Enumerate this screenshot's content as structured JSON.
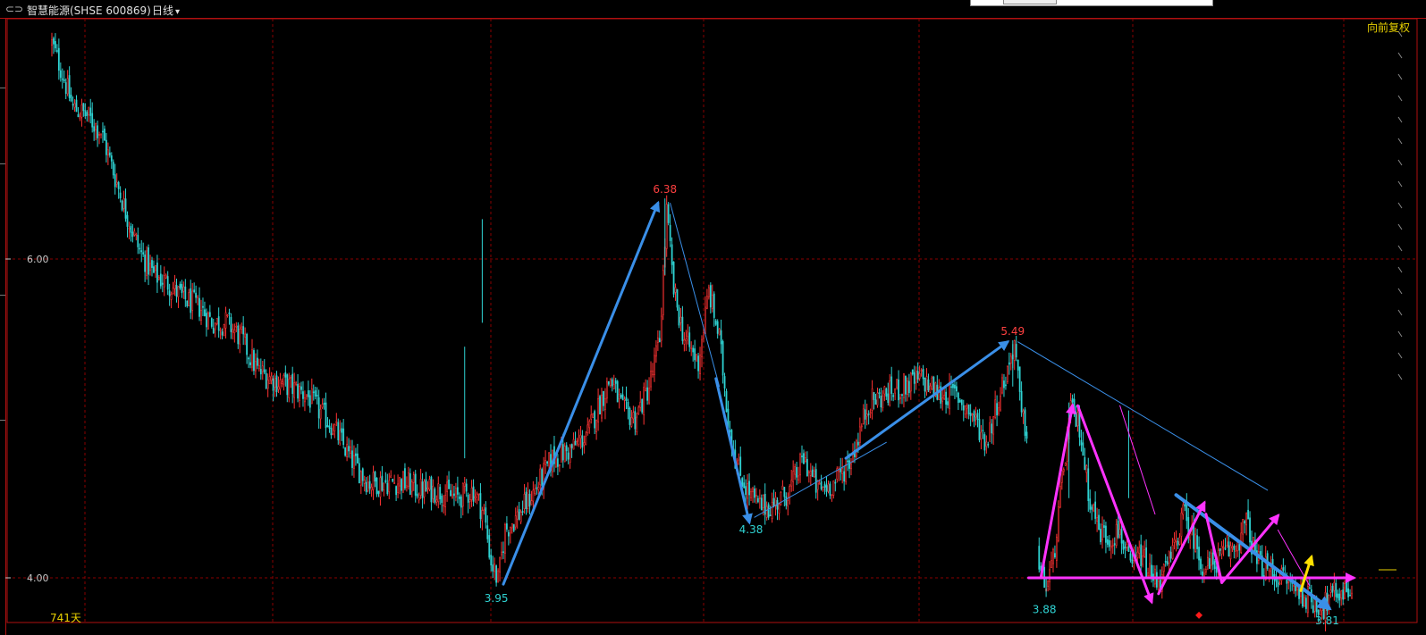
{
  "window": {
    "grip_icon": "⊂⊃",
    "stock_title": "智慧能源(SHSE 600869)",
    "period": "日线",
    "adjust": "向前复权",
    "day_count": "741天"
  },
  "colors": {
    "up": "#ff3333",
    "down": "#2fd3d3",
    "grid": "#8a0000",
    "trend_blue": "#3a8fe8",
    "trend_magenta": "#ff33ff",
    "trend_yellow": "#ffe000",
    "high_label": "#ff4040",
    "low_label": "#2fd3d3"
  },
  "chart_data": {
    "type": "candlestick",
    "title": "智慧能源(SHSE 600869) 日线",
    "ylim": [
      3.78,
      7.4
    ],
    "y_ticks": [
      "6.00",
      "4.00"
    ],
    "y_tick_values": [
      6.0,
      4.0
    ],
    "trading_days": 741,
    "grid": true,
    "price_profile": [
      [
        0,
        7.35
      ],
      [
        5,
        7.2
      ],
      [
        12,
        6.95
      ],
      [
        20,
        6.9
      ],
      [
        28,
        6.8
      ],
      [
        35,
        6.55
      ],
      [
        42,
        6.3
      ],
      [
        50,
        6.05
      ],
      [
        58,
        5.9
      ],
      [
        66,
        5.85
      ],
      [
        75,
        5.75
      ],
      [
        84,
        5.7
      ],
      [
        92,
        5.6
      ],
      [
        100,
        5.6
      ],
      [
        108,
        5.5
      ],
      [
        117,
        5.3
      ],
      [
        125,
        5.25
      ],
      [
        135,
        5.2
      ],
      [
        145,
        5.15
      ],
      [
        152,
        5.05
      ],
      [
        160,
        4.95
      ],
      [
        170,
        4.75
      ],
      [
        180,
        4.6
      ],
      [
        190,
        4.6
      ],
      [
        200,
        4.6
      ],
      [
        210,
        4.55
      ],
      [
        220,
        4.55
      ],
      [
        230,
        4.5
      ],
      [
        240,
        4.55
      ],
      [
        246,
        4.4
      ],
      [
        250,
        4.1
      ],
      [
        254,
        3.98
      ],
      [
        258,
        4.3
      ],
      [
        266,
        4.4
      ],
      [
        275,
        4.55
      ],
      [
        285,
        4.75
      ],
      [
        295,
        4.8
      ],
      [
        305,
        4.9
      ],
      [
        312,
        5.1
      ],
      [
        318,
        5.25
      ],
      [
        325,
        5.05
      ],
      [
        332,
        5.0
      ],
      [
        340,
        5.2
      ],
      [
        346,
        5.5
      ],
      [
        350,
        6.3
      ],
      [
        354,
        5.8
      ],
      [
        360,
        5.5
      ],
      [
        368,
        5.35
      ],
      [
        374,
        5.8
      ],
      [
        380,
        5.5
      ],
      [
        385,
        5.0
      ],
      [
        390,
        4.7
      ],
      [
        396,
        4.55
      ],
      [
        402,
        4.45
      ],
      [
        410,
        4.45
      ],
      [
        420,
        4.55
      ],
      [
        428,
        4.75
      ],
      [
        436,
        4.55
      ],
      [
        446,
        4.6
      ],
      [
        455,
        4.75
      ],
      [
        465,
        5.1
      ],
      [
        475,
        5.15
      ],
      [
        485,
        5.2
      ],
      [
        495,
        5.25
      ],
      [
        505,
        5.15
      ],
      [
        515,
        5.15
      ],
      [
        525,
        5.0
      ],
      [
        532,
        4.85
      ],
      [
        538,
        5.1
      ],
      [
        544,
        5.3
      ],
      [
        548,
        5.48
      ],
      [
        552,
        5.0
      ],
      [
        556,
        4.9
      ],
      [
        562,
        4.05
      ],
      [
        566,
        3.95
      ],
      [
        570,
        4.1
      ],
      [
        575,
        4.6
      ],
      [
        580,
        5.05
      ],
      [
        585,
        4.95
      ],
      [
        590,
        4.55
      ],
      [
        596,
        4.3
      ],
      [
        602,
        4.25
      ],
      [
        608,
        4.3
      ],
      [
        614,
        4.05
      ],
      [
        620,
        4.15
      ],
      [
        626,
        4.0
      ],
      [
        632,
        4.0
      ],
      [
        638,
        4.15
      ],
      [
        644,
        4.4
      ],
      [
        650,
        4.25
      ],
      [
        656,
        4.05
      ],
      [
        662,
        4.1
      ],
      [
        668,
        4.15
      ],
      [
        674,
        4.2
      ],
      [
        680,
        4.35
      ],
      [
        686,
        4.1
      ],
      [
        692,
        4.05
      ],
      [
        700,
        4.0
      ],
      [
        706,
        3.95
      ],
      [
        712,
        3.9
      ],
      [
        718,
        3.85
      ],
      [
        724,
        3.82
      ],
      [
        730,
        3.9
      ],
      [
        736,
        3.92
      ],
      [
        740,
        3.95
      ]
    ],
    "gaps": [
      [
        556,
        561
      ]
    ],
    "annotations": [
      {
        "label": "6.38",
        "x": 349,
        "y": 6.38,
        "kind": "high"
      },
      {
        "label": "3.95",
        "x": 253,
        "y": 3.95,
        "kind": "low"
      },
      {
        "label": "4.38",
        "x": 398,
        "y": 4.38,
        "kind": "low"
      },
      {
        "label": "5.49",
        "x": 547,
        "y": 5.49,
        "kind": "high"
      },
      {
        "label": "3.88",
        "x": 565,
        "y": 3.88,
        "kind": "low"
      },
      {
        "label": "3.81",
        "x": 726,
        "y": 3.81,
        "kind": "low"
      }
    ],
    "trend_lines": [
      {
        "color": "blue",
        "from": [
          257,
          3.96
        ],
        "to": [
          345,
          6.35
        ],
        "arrow": true,
        "width": 3
      },
      {
        "color": "blue",
        "from": [
          352,
          6.35
        ],
        "to": [
          380,
          5.2
        ],
        "arrow": false,
        "width": 1
      },
      {
        "color": "blue",
        "from": [
          378,
          5.25
        ],
        "to": [
          397,
          4.35
        ],
        "arrow": true,
        "width": 3
      },
      {
        "color": "blue",
        "from": [
          400,
          4.38
        ],
        "to": [
          475,
          4.85
        ],
        "arrow": false,
        "width": 1
      },
      {
        "color": "blue",
        "from": [
          452,
          4.75
        ],
        "to": [
          544,
          5.48
        ],
        "arrow": true,
        "width": 3
      },
      {
        "color": "blue",
        "from": [
          550,
          5.48
        ],
        "to": [
          692,
          4.55
        ],
        "arrow": false,
        "width": 1
      },
      {
        "color": "blue",
        "from": [
          640,
          4.52
        ],
        "to": [
          727,
          3.81
        ],
        "arrow": true,
        "width": 4
      },
      {
        "color": "magenta",
        "from": [
          556,
          4.0
        ],
        "to": [
          741,
          4.0
        ],
        "arrow": true,
        "width": 3
      },
      {
        "color": "magenta",
        "from": [
          563,
          4.0
        ],
        "to": [
          581,
          5.08
        ],
        "arrow": true,
        "width": 3
      },
      {
        "color": "magenta",
        "from": [
          584,
          5.08
        ],
        "to": [
          626,
          3.85
        ],
        "arrow": true,
        "width": 3
      },
      {
        "color": "magenta",
        "from": [
          608,
          5.08
        ],
        "to": [
          628,
          4.4
        ],
        "arrow": false,
        "width": 1
      },
      {
        "color": "magenta",
        "from": [
          630,
          3.9
        ],
        "to": [
          656,
          4.47
        ],
        "arrow": true,
        "width": 3
      },
      {
        "color": "magenta",
        "from": [
          657,
          4.4
        ],
        "to": [
          666,
          3.97
        ],
        "arrow": false,
        "width": 3
      },
      {
        "color": "magenta",
        "from": [
          666,
          3.97
        ],
        "to": [
          698,
          4.39
        ],
        "arrow": true,
        "width": 3
      },
      {
        "color": "magenta",
        "from": [
          698,
          4.3
        ],
        "to": [
          716,
          3.95
        ],
        "arrow": false,
        "width": 1
      },
      {
        "color": "yellow",
        "from": [
          711,
          3.92
        ],
        "to": [
          717,
          4.13
        ],
        "arrow": true,
        "width": 3
      }
    ],
    "marker": {
      "x": 653,
      "y": 3.81,
      "shape": "diamond",
      "color": "#ff1a1a"
    }
  }
}
